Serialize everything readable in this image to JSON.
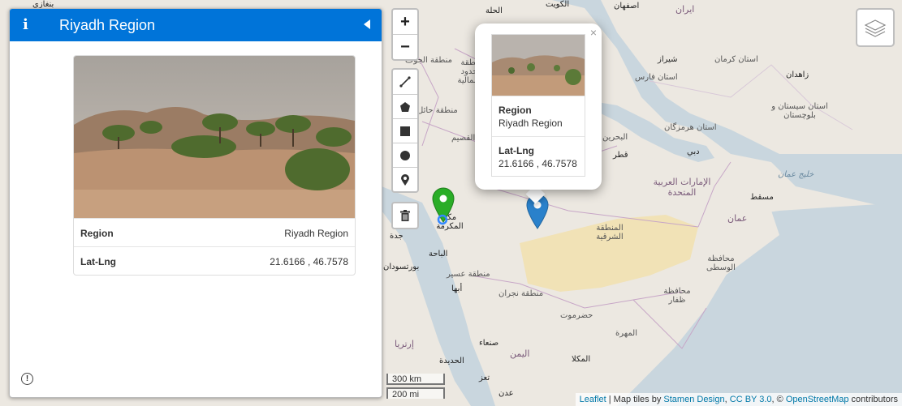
{
  "sidebar": {
    "title": "Riyadh Region",
    "info_icon": "info-icon",
    "collapse_icon": "caret-left-icon",
    "card": {
      "region_label": "Region",
      "region_value": "Riyadh Region",
      "latlng_label": "Lat-Lng",
      "latlng_value": "21.6166 , 46.7578"
    },
    "footer_icon": "exclamation-circle-icon",
    "footer_icon_text": "!"
  },
  "zoom": {
    "in_label": "+",
    "out_label": "−"
  },
  "draw_tools": [
    "polyline-icon",
    "polygon-icon",
    "rectangle-icon",
    "circle-icon",
    "marker-icon",
    "trash-icon"
  ],
  "popup": {
    "close_label": "×",
    "region_label": "Region",
    "region_value": "Riyadh Region",
    "latlng_label": "Lat-Lng",
    "latlng_value": "21.6166 , 46.7578"
  },
  "layers_icon": "layers-icon",
  "scale": {
    "km": "300 km",
    "mi": "200 mi"
  },
  "attribution": {
    "leaflet": "Leaflet",
    "sep1": " | Map tiles by ",
    "stamen": "Stamen Design",
    "comma": ", ",
    "ccby": "CC BY 3.0",
    "sep2": ", © ",
    "osm": "OpenStreetMap",
    "contributors": " contributors"
  },
  "map_labels": {
    "kuwait": "الكويت",
    "isfahan": "اصفهان",
    "iran": "ایران",
    "shiraz": "شیراز",
    "fars": "استان فارس",
    "kerman": "استان کرمان",
    "zahedan": "زاهدان",
    "sistan": "استان سیستان و بلوچستان",
    "hormozgan": "استان هرمزگان",
    "dubai": "دبي",
    "qatar": "قطر",
    "bahrain": "البحرين",
    "uae": "الإمارات العربية المتحدة",
    "gulf_oman": "خليج عمان",
    "muscat": "مسقط",
    "oman": "عمان",
    "eastern_province": "المنطقة الشرقية",
    "wusta": "محافظة الوسطى",
    "dhofar": "محافظة ظفار",
    "hail": "منطقة حائل",
    "qassim": "القصيم",
    "northern_borders": "منطقة الحدود الشمالية",
    "jawf": "منطقة الجوف",
    "makkah": "مكة المكرمة",
    "jeddah": "جدة",
    "baha": "الباحة",
    "asir": "منطقة عسير",
    "abha": "أبها",
    "najran": "منطقة نجران",
    "hadramaut": "حضرموت",
    "mahra": "المهرة",
    "yemen": "اليمن",
    "sanaa": "صنعاء",
    "mukalla": "المكلا",
    "hudaydah": "الحديدة",
    "taiz": "تعز",
    "aden": "عدن",
    "eritrea": "إرتريا",
    "port_sudan": "بورتسودان",
    "benghazi": "بنغازي",
    "hilla": "الحلة"
  },
  "colors": {
    "sidebar_header": "#0074d9",
    "marker_blue": "#2a81cb",
    "marker_green": "#2aad27",
    "sea": "#c9d6de",
    "land": "#ece8e1",
    "desert": "#f1e2b6"
  }
}
